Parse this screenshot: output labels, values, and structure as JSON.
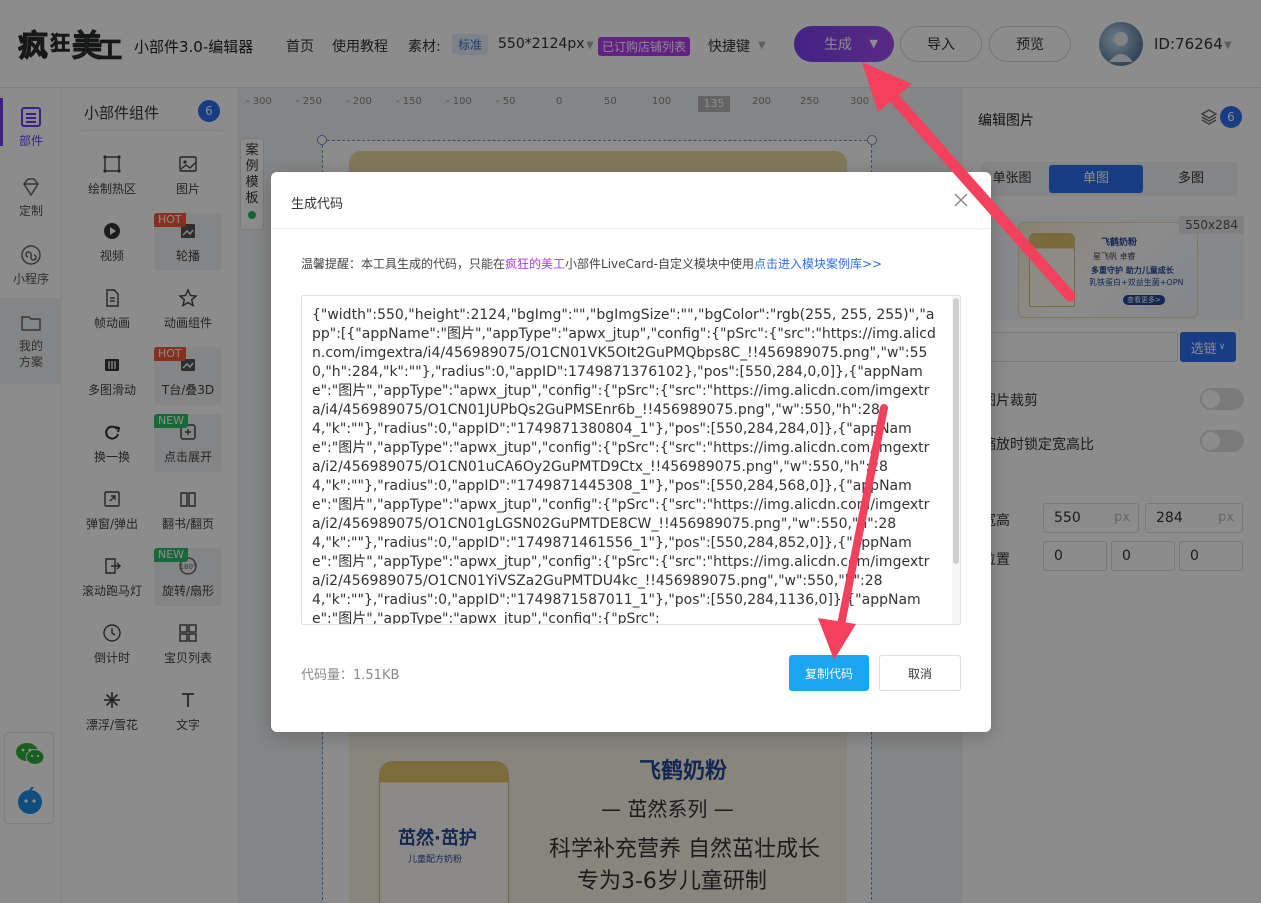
{
  "topbar": {
    "app_title": "小部件3.0-编辑器",
    "nav_home": "首页",
    "nav_tutorial": "使用教程",
    "material_label": "素材:",
    "material_tag": "标准",
    "material_size": "550*2124px",
    "shop_badge": "已订购店铺列表",
    "shortcut": "快捷键",
    "generate_label": "生成",
    "import_label": "导入",
    "preview_label": "预览",
    "user_id": "ID:76264"
  },
  "rail": {
    "items": [
      {
        "label": "部件",
        "icon": "widgets-icon"
      },
      {
        "label": "定制",
        "icon": "diamond-icon"
      },
      {
        "label": "小程序",
        "icon": "miniprogram-icon"
      },
      {
        "label": "我的方案",
        "icon": "folder-icon"
      }
    ]
  },
  "components": {
    "title": "小部件组件",
    "count": "6",
    "hot_badge": "HOT",
    "new_badge": "NEW",
    "items": [
      "绘制热区",
      "图片",
      "视频",
      "轮播",
      "帧动画",
      "动画组件",
      "多图滑动",
      "T台/叠3D",
      "换一换",
      "点击展开",
      "弹窗/弹出",
      "翻书/翻页",
      "滚动跑马灯",
      "旋转/扇形",
      "倒计时",
      "宝贝列表",
      "漂浮/雪花",
      "文字"
    ]
  },
  "canvas": {
    "ruler_labels": [
      "- 300",
      "- 250",
      "- 200",
      "- 150",
      "- 100",
      "- 50",
      "0",
      "50",
      "100",
      "135",
      "200",
      "250",
      "300"
    ],
    "ruler_marker": "135",
    "case_tab": "案例模板",
    "product": {
      "can_name": "茁然·茁护",
      "can_sub": "儿童配方奶粉",
      "brand": "飞鹤奶粉",
      "series": "— 茁然系列 —",
      "slogan_1": "科学补充营养 自然茁壮成长",
      "slogan_2": "专为3-6岁儿童研制"
    }
  },
  "right_panel": {
    "title": "编辑图片",
    "count": "6",
    "seg_left": "单张图",
    "seg_single": "单图",
    "seg_multi": "多图",
    "thumb_size": "550x284",
    "thumb_lines": [
      "飞鹤奶粉",
      "星飞帆 卓睿",
      "多重守护 助力儿童成长",
      "乳铁蛋白+双益生菌+OPN",
      "查看更多>"
    ],
    "select_btn": "选链",
    "crop_label": "图片裁剪",
    "lock_label": "缩放时锁定宽高比",
    "size_label": "宽高",
    "width": "550",
    "height": "284",
    "unit": "px",
    "pos_label": "位置",
    "pos_x": "0",
    "pos_y": "0",
    "pos_z": "0"
  },
  "modal": {
    "title": "生成代码",
    "tip_prefix": "温馨提醒：本工具生成的代码，只能在",
    "tip_brand": "疯狂的美工",
    "tip_middle": "小部件LiveCard-自定义模块中使用",
    "tip_link": "点击进入模块案例库>>",
    "code": "{\"width\":550,\"height\":2124,\"bgImg\":\"\",\"bgImgSize\":\"\",\"bgColor\":\"rgb(255, 255, 255)\",\"app\":[{\"appName\":\"图片\",\"appType\":\"apwx_jtup\",\"config\":{\"pSrc\":{\"src\":\"https://img.alicdn.com/imgextra/i4/456989075/O1CN01VK5OIt2GuPMQbps8C_!!456989075.png\",\"w\":550,\"h\":284,\"k\":\"\"},\"radius\":0,\"appID\":1749871376102},\"pos\":[550,284,0,0]},{\"appName\":\"图片\",\"appType\":\"apwx_jtup\",\"config\":{\"pSrc\":{\"src\":\"https://img.alicdn.com/imgextra/i4/456989075/O1CN01JUPbQs2GuPMSEnr6b_!!456989075.png\",\"w\":550,\"h\":284,\"k\":\"\"},\"radius\":0,\"appID\":\"1749871380804_1\"},\"pos\":[550,284,284,0]},{\"appName\":\"图片\",\"appType\":\"apwx_jtup\",\"config\":{\"pSrc\":{\"src\":\"https://img.alicdn.com/imgextra/i2/456989075/O1CN01uCA6Oy2GuPMTD9Ctx_!!456989075.png\",\"w\":550,\"h\":284,\"k\":\"\"},\"radius\":0,\"appID\":\"1749871445308_1\"},\"pos\":[550,284,568,0]},{\"appName\":\"图片\",\"appType\":\"apwx_jtup\",\"config\":{\"pSrc\":{\"src\":\"https://img.alicdn.com/imgextra/i2/456989075/O1CN01gLGSN02GuPMTDE8CW_!!456989075.png\",\"w\":550,\"h\":284,\"k\":\"\"},\"radius\":0,\"appID\":\"1749871461556_1\"},\"pos\":[550,284,852,0]},{\"appName\":\"图片\",\"appType\":\"apwx_jtup\",\"config\":{\"pSrc\":{\"src\":\"https://img.alicdn.com/imgextra/i2/456989075/O1CN01YiVSZa2GuPMTDU4kc_!!456989075.png\",\"w\":550,\"h\":284,\"k\":\"\"},\"radius\":0,\"appID\":\"1749871587011_1\"},\"pos\":[550,284,1136,0]},{\"appName\":\"图片\",\"appType\":\"apwx_jtup\",\"config\":{\"pSrc\":",
    "code_size": "代码量：1.51KB",
    "copy_btn": "复制代码",
    "cancel_btn": "取消"
  },
  "colors": {
    "accent_purple": "#7b3ff2",
    "primary_blue": "#2f6ff2",
    "copy_blue": "#1aa6f0",
    "arrow_red": "#f2405d"
  }
}
